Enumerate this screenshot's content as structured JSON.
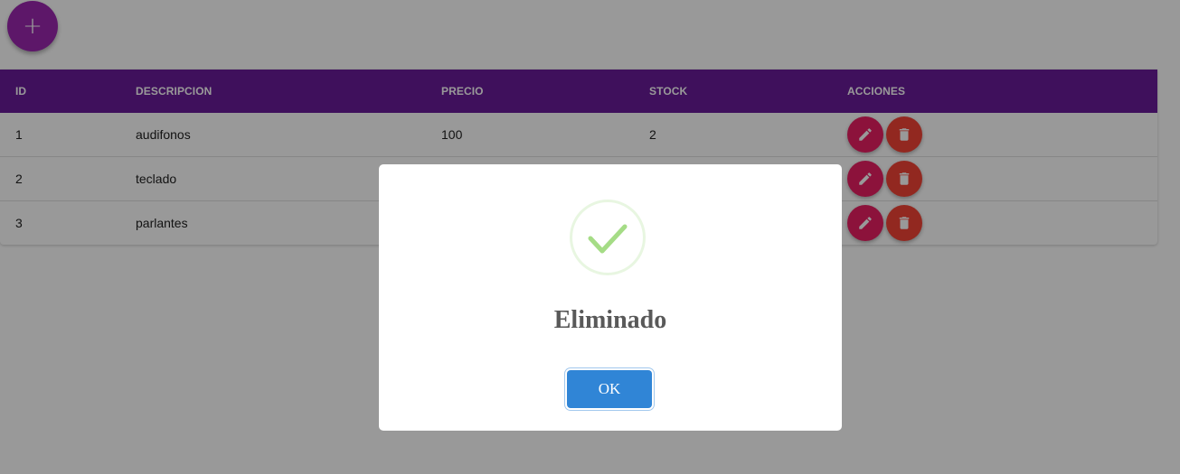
{
  "fab": {
    "label": "+",
    "icon": "plus-icon"
  },
  "table": {
    "headers": {
      "id": "ID",
      "descripcion": "DESCRIPCION",
      "precio": "PRECIO",
      "stock": "STOCK",
      "acciones": "ACCIONES"
    },
    "rows": [
      {
        "id": "1",
        "descripcion": "audifonos",
        "precio": "100",
        "stock": "2"
      },
      {
        "id": "2",
        "descripcion": "teclado",
        "precio": "",
        "stock": ""
      },
      {
        "id": "3",
        "descripcion": "parlantes",
        "precio": "",
        "stock": ""
      }
    ],
    "row_action_icons": [
      "pencil-icon",
      "trash-icon"
    ]
  },
  "dialog": {
    "icon": "check-success-icon",
    "title": "Eliminado",
    "confirm_label": "OK"
  },
  "colors": {
    "header_bg": "#6a1b9a",
    "fab": "#9c27b0",
    "edit_button": "#e91e63",
    "delete_button": "#f44336",
    "ok_button": "#3085d6",
    "success_check": "#a5dc86"
  }
}
